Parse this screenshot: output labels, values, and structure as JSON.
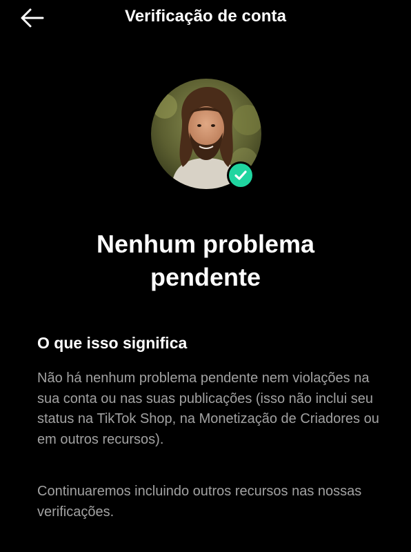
{
  "header": {
    "title": "Verificação de conta",
    "back_icon": "arrow-left-icon"
  },
  "profile": {
    "badge_icon": "checkmark-icon",
    "badge_color": "#20d5a0"
  },
  "status": {
    "headline_line1": "Nenhum problema",
    "headline_line2": "pendente"
  },
  "details": {
    "section_title": "O que isso significa",
    "paragraph1": "Não há nenhum problema pendente nem violações na sua conta ou nas suas publicações (isso não inclui seu status na TikTok Shop, na Monetização de Criadores ou em outros recursos).",
    "paragraph2": "Continuaremos incluindo outros recursos nas nossas verificações."
  }
}
